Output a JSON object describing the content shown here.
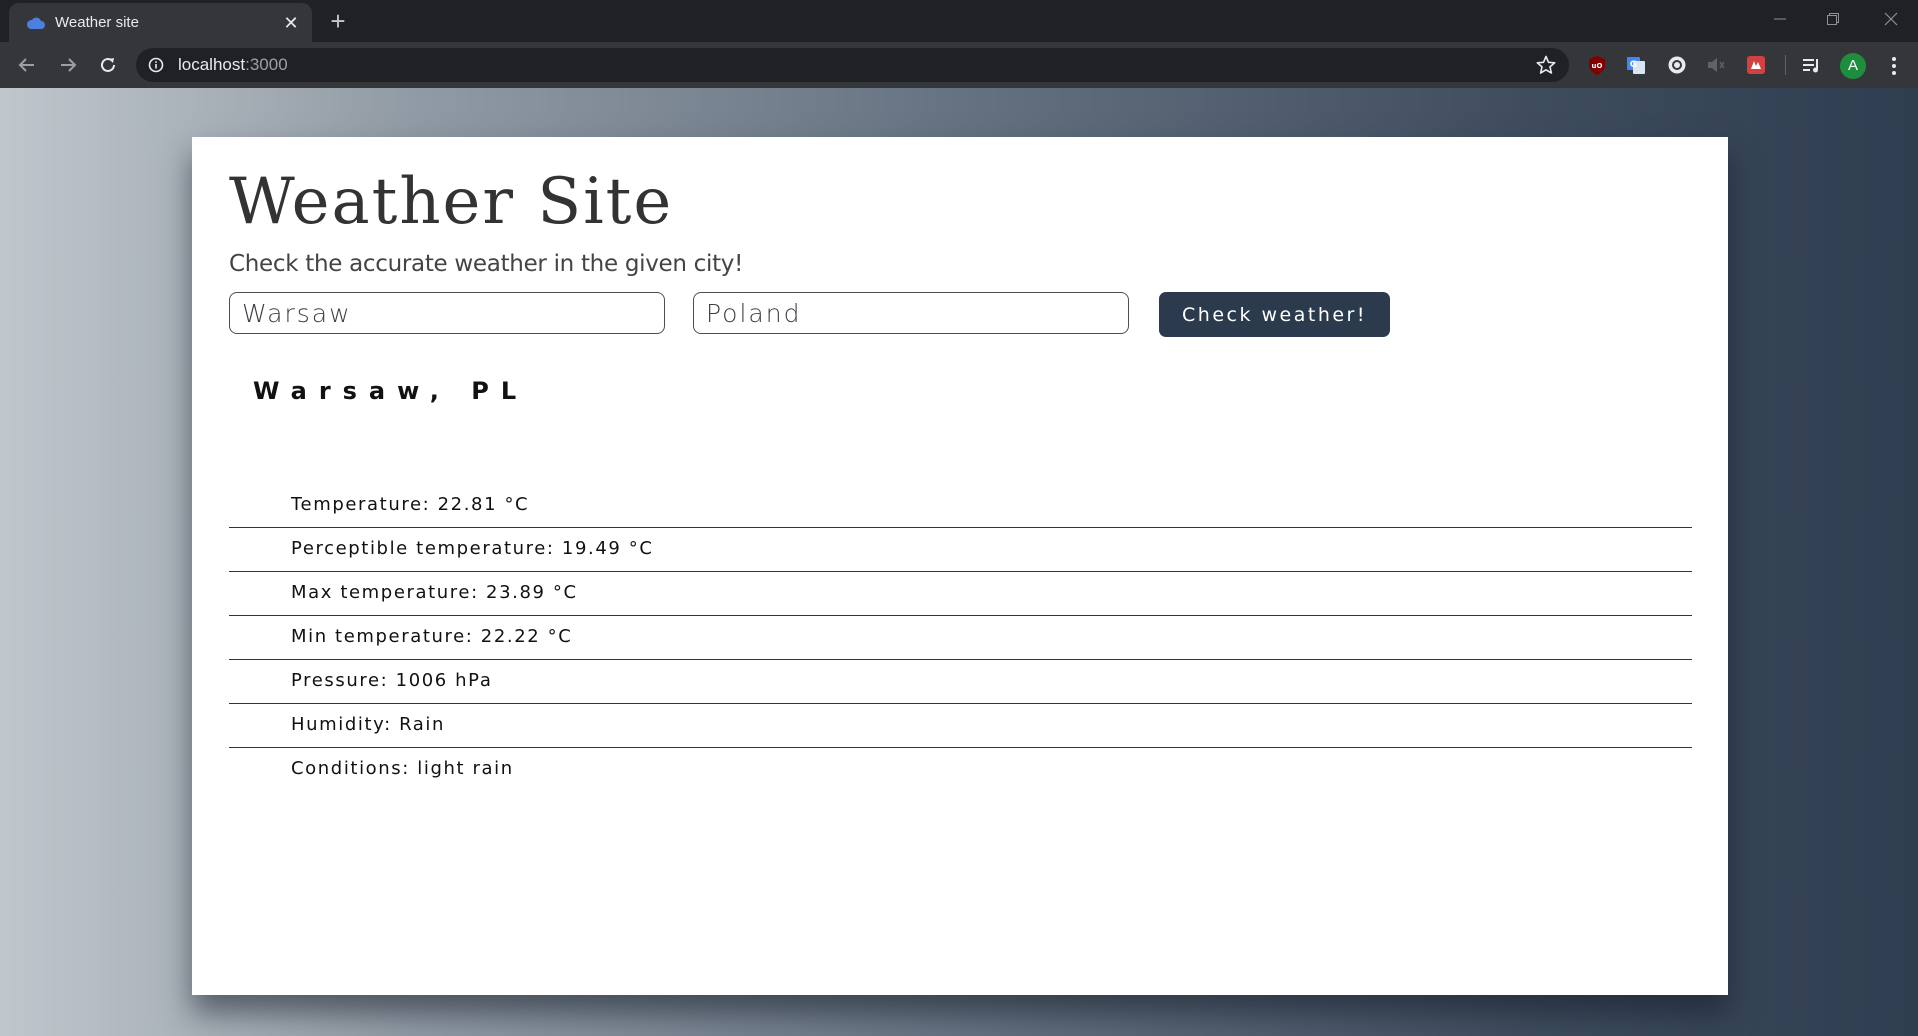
{
  "browser": {
    "tab_title": "Weather site",
    "new_tab_label": "+",
    "close_tab_label": "✕",
    "url_host": "localhost",
    "url_port": ":3000",
    "profile_initial": "A",
    "icons": [
      "back-icon",
      "forward-icon",
      "reload-icon",
      "info-icon",
      "star-icon",
      "ublock-icon",
      "translate-icon",
      "extension-icon",
      "mute-icon",
      "extension-red-icon",
      "media-icon",
      "menu-icon"
    ]
  },
  "page": {
    "title": "Weather Site",
    "subtitle": "Check the accurate weather in the given city!",
    "city_value": "Warsaw",
    "country_value": "Poland",
    "check_button_label": "Check weather!",
    "location": "Warsaw, PL",
    "stats": [
      "Temperature: 22.81 °C",
      "Perceptible temperature: 19.49 °C",
      "Max temperature: 23.89 °C",
      "Min temperature: 22.22 °C",
      "Pressure: 1006 hPa",
      "Humidity: Rain",
      "Conditions: light rain"
    ]
  },
  "colors": {
    "card_background": "#ffffff",
    "button_background": "#2b3a4d",
    "avatar_background": "#1e8e3e"
  }
}
